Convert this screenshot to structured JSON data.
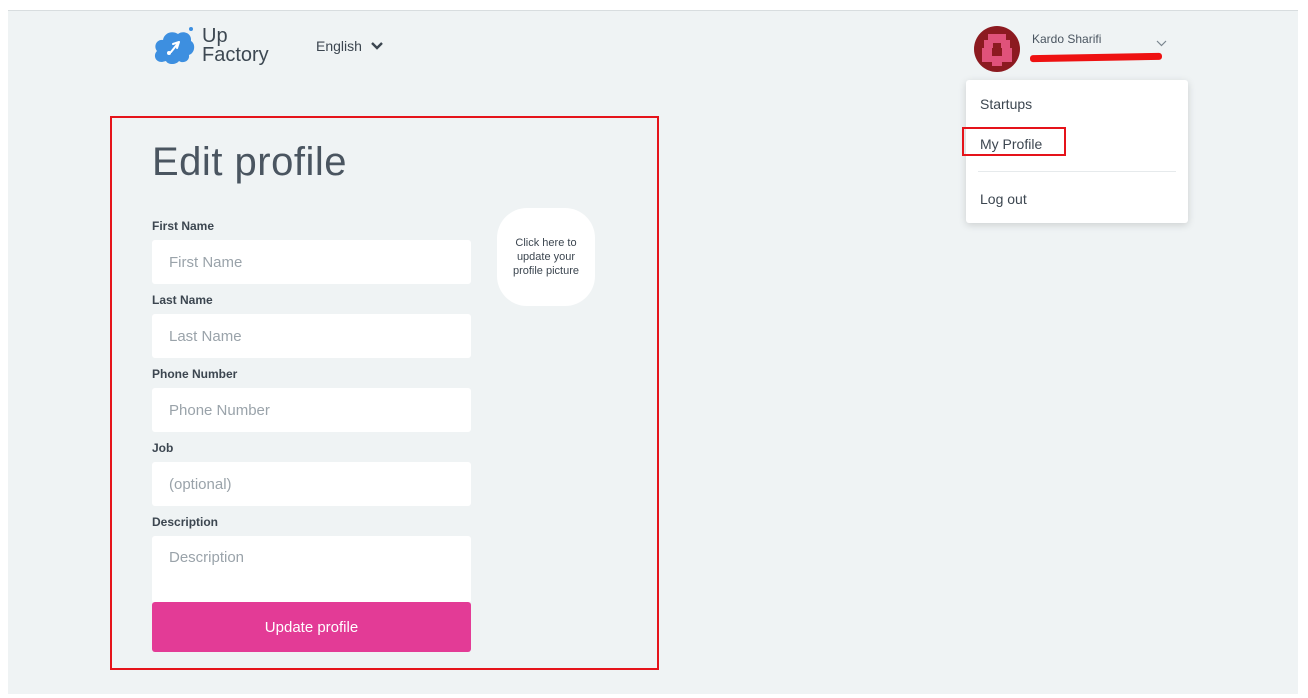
{
  "header": {
    "logo_line1": "Up",
    "logo_line2": "Factory",
    "language": "English"
  },
  "user": {
    "name": "Kardo Sharifi"
  },
  "dropdown": {
    "items": [
      {
        "label": "Startups"
      },
      {
        "label": "My Profile"
      },
      {
        "label": "Log out"
      }
    ]
  },
  "form": {
    "title": "Edit profile",
    "first_name": {
      "label": "First Name",
      "placeholder": "First Name",
      "value": ""
    },
    "last_name": {
      "label": "Last Name",
      "placeholder": "Last Name",
      "value": ""
    },
    "phone": {
      "label": "Phone Number",
      "placeholder": "Phone Number",
      "value": ""
    },
    "job": {
      "label": "Job",
      "placeholder": "(optional)",
      "value": ""
    },
    "description": {
      "label": "Description",
      "placeholder": "Description",
      "value": ""
    },
    "picture_hint": "Click here to update your profile picture",
    "submit_label": "Update profile"
  },
  "colors": {
    "background": "#eff3f4",
    "accent": "#e33b96",
    "logo_blue": "#3d8fe0",
    "highlight": "#e5131a"
  }
}
